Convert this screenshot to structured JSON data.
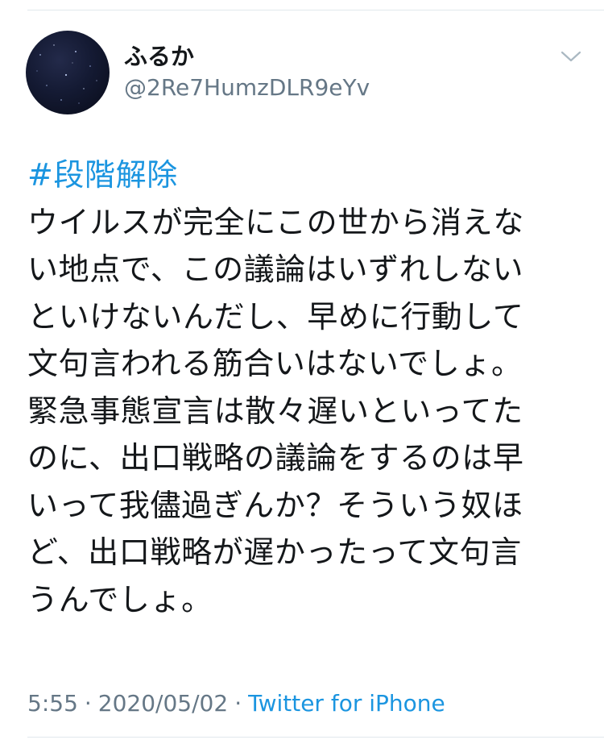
{
  "user": {
    "display_name": "ふるか",
    "handle": "@2Re7HumzDLR9eYv",
    "avatar_icon": "night-sky-avatar"
  },
  "tweet": {
    "hashtag": "#段階解除",
    "lines": [
      "ウイルスが完全にこの世から消えな",
      "い地点で、この議論はいずれしない",
      "といけないんだし、早めに行動して",
      "文句言われる筋合いはないでしょ。",
      "緊急事態宣言は散々遅いといってた",
      "のに、出口戦略の議論をするのは早",
      "いって我儘過ぎんか？そういう奴ほ",
      "ど、出口戦略が遅かったって文句言",
      "うんでしょ。"
    ]
  },
  "meta": {
    "time": "5:55",
    "separator": "·",
    "date": "2020/05/02",
    "source": "Twitter for iPhone"
  },
  "colors": {
    "text": "#14171a",
    "secondary": "#657786",
    "link": "#1b95e0",
    "divider": "#e1e8ed"
  },
  "icons": {
    "menu": "chevron-down-icon"
  }
}
